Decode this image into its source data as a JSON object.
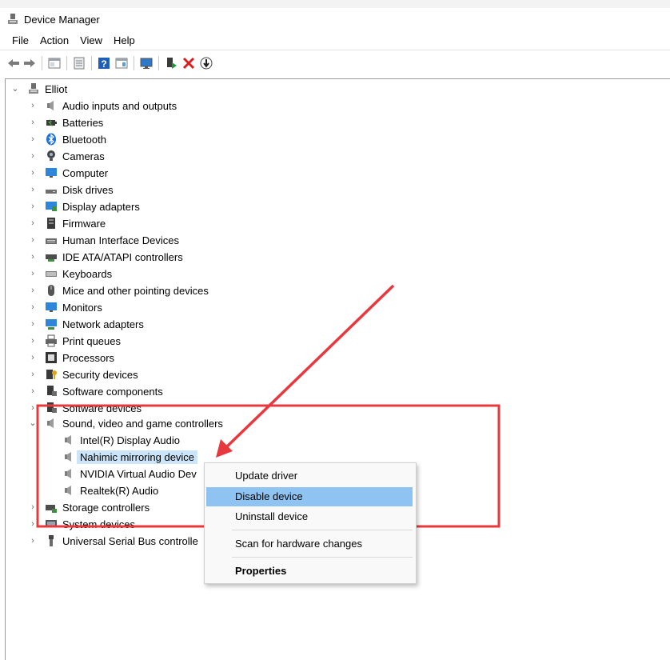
{
  "window": {
    "title": "Device Manager"
  },
  "menubar": [
    "File",
    "Action",
    "View",
    "Help"
  ],
  "tree": {
    "root": "Elliot",
    "categories": [
      {
        "label": "Audio inputs and outputs",
        "icon": "speaker-icon"
      },
      {
        "label": "Batteries",
        "icon": "battery-icon"
      },
      {
        "label": "Bluetooth",
        "icon": "bluetooth-icon"
      },
      {
        "label": "Cameras",
        "icon": "camera-icon"
      },
      {
        "label": "Computer",
        "icon": "monitor-icon"
      },
      {
        "label": "Disk drives",
        "icon": "disk-drive-icon"
      },
      {
        "label": "Display adapters",
        "icon": "display-adapter-icon"
      },
      {
        "label": "Firmware",
        "icon": "firmware-icon"
      },
      {
        "label": "Human Interface Devices",
        "icon": "hid-icon"
      },
      {
        "label": "IDE ATA/ATAPI controllers",
        "icon": "ide-controller-icon"
      },
      {
        "label": "Keyboards",
        "icon": "keyboard-icon"
      },
      {
        "label": "Mice and other pointing devices",
        "icon": "mouse-icon"
      },
      {
        "label": "Monitors",
        "icon": "monitor-icon"
      },
      {
        "label": "Network adapters",
        "icon": "network-adapter-icon"
      },
      {
        "label": "Print queues",
        "icon": "printer-icon"
      },
      {
        "label": "Processors",
        "icon": "processor-icon"
      },
      {
        "label": "Security devices",
        "icon": "security-device-icon"
      },
      {
        "label": "Software components",
        "icon": "software-component-icon"
      },
      {
        "label": "Software devices",
        "icon": "software-device-icon"
      }
    ],
    "expanded_category": "Sound, video and game controllers",
    "children": [
      {
        "label": "Intel(R) Display Audio"
      },
      {
        "label": "Nahimic mirroring device",
        "selected": true
      },
      {
        "label": "NVIDIA Virtual Audio Dev"
      },
      {
        "label": "Realtek(R) Audio"
      }
    ],
    "after": [
      {
        "label": "Storage controllers",
        "icon": "storage-controller-icon"
      },
      {
        "label": "System devices",
        "icon": "system-device-icon"
      },
      {
        "label": "Universal Serial Bus controlle",
        "icon": "usb-icon"
      }
    ]
  },
  "context_menu": {
    "items": [
      "Update driver",
      "Disable device",
      "Uninstall device",
      "Scan for hardware changes",
      "Properties"
    ],
    "highlighted": "Disable device"
  },
  "annotation": {
    "color": "#e8383d"
  },
  "colors": {
    "selection": "#cce4f7",
    "menu_highlight": "#8fc3f1"
  }
}
